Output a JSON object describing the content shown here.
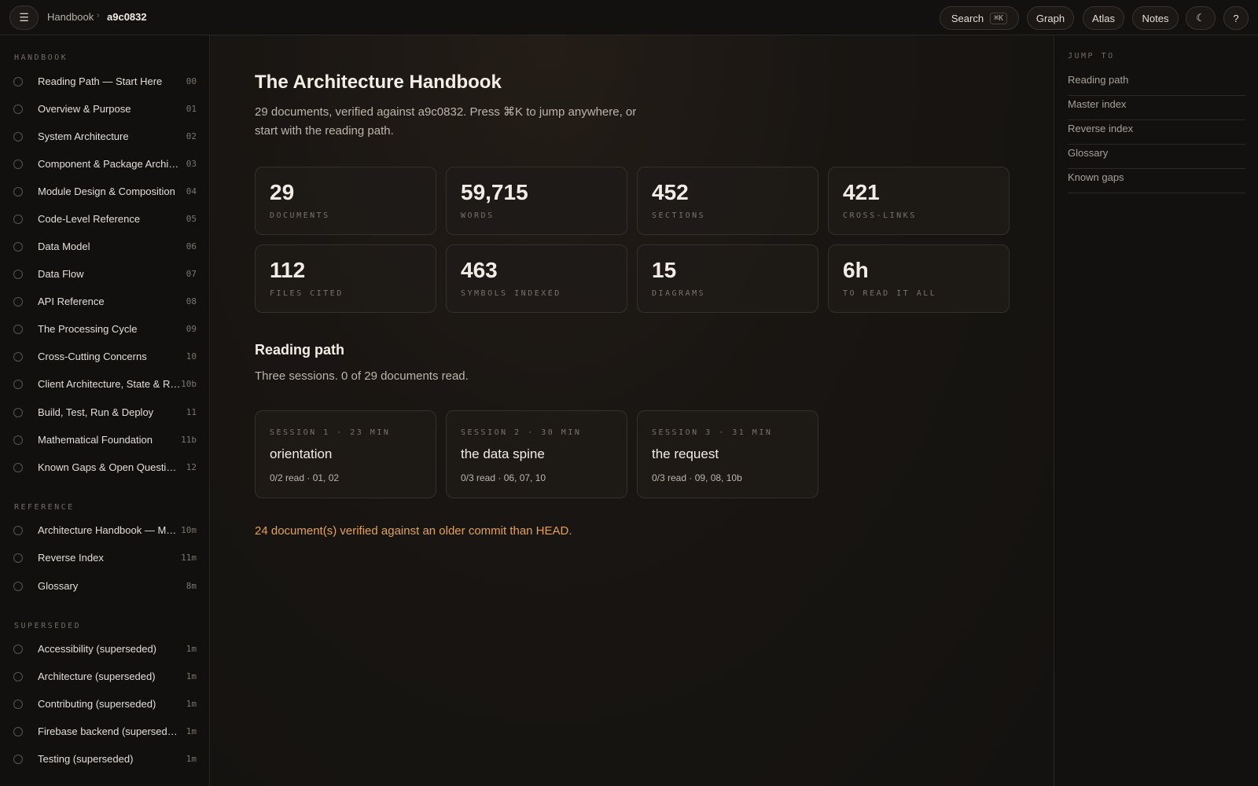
{
  "topbar": {
    "menu_icon": "☰",
    "breadcrumb_root": "Handbook",
    "breadcrumb_sep": "›",
    "breadcrumb_current": "a9c0832",
    "search_label": "Search",
    "search_shortcut": "⌘K",
    "graph_label": "Graph",
    "atlas_label": "Atlas",
    "notes_label": "Notes",
    "theme_icon": "☾",
    "help_label": "?"
  },
  "sidebar": {
    "sections": [
      {
        "label": "HANDBOOK",
        "items": [
          {
            "label": "Reading Path — Start Here",
            "num": "00"
          },
          {
            "label": "Overview & Purpose",
            "num": "01"
          },
          {
            "label": "System Architecture",
            "num": "02"
          },
          {
            "label": "Component & Package Architecture",
            "num": "03"
          },
          {
            "label": "Module Design & Composition",
            "num": "04"
          },
          {
            "label": "Code-Level Reference",
            "num": "05"
          },
          {
            "label": "Data Model",
            "num": "06"
          },
          {
            "label": "Data Flow",
            "num": "07"
          },
          {
            "label": "API Reference",
            "num": "08"
          },
          {
            "label": "The Processing Cycle",
            "num": "09"
          },
          {
            "label": "Cross-Cutting Concerns",
            "num": "10"
          },
          {
            "label": "Client Architecture, State & Rendering",
            "num": "10b"
          },
          {
            "label": "Build, Test, Run & Deploy",
            "num": "11"
          },
          {
            "label": "Mathematical Foundation",
            "num": "11b"
          },
          {
            "label": "Known Gaps & Open Questions",
            "num": "12"
          }
        ]
      },
      {
        "label": "REFERENCE",
        "items": [
          {
            "label": "Architecture Handbook — Master Index",
            "num": "10m"
          },
          {
            "label": "Reverse Index",
            "num": "11m"
          },
          {
            "label": "Glossary",
            "num": "8m"
          }
        ]
      },
      {
        "label": "SUPERSEDED",
        "items": [
          {
            "label": "Accessibility (superseded)",
            "num": "1m"
          },
          {
            "label": "Architecture (superseded)",
            "num": "1m"
          },
          {
            "label": "Contributing (superseded)",
            "num": "1m"
          },
          {
            "label": "Firebase backend (superseded)",
            "num": "1m"
          },
          {
            "label": "Testing (superseded)",
            "num": "1m"
          }
        ]
      }
    ]
  },
  "main": {
    "title": "The Architecture Handbook",
    "subtitle": "29 documents, verified against a9c0832. Press ⌘K to jump anywhere, or start with the reading path.",
    "stats": [
      {
        "value": "29",
        "label": "DOCUMENTS"
      },
      {
        "value": "59,715",
        "label": "WORDS"
      },
      {
        "value": "452",
        "label": "SECTIONS"
      },
      {
        "value": "421",
        "label": "CROSS-LINKS"
      },
      {
        "value": "112",
        "label": "FILES CITED"
      },
      {
        "value": "463",
        "label": "SYMBOLS INDEXED"
      },
      {
        "value": "15",
        "label": "DIAGRAMS"
      },
      {
        "value": "6h",
        "label": "TO READ IT ALL"
      }
    ],
    "reading_path": {
      "title": "Reading path",
      "subtitle": "Three sessions. 0 of 29 documents read.",
      "sessions": [
        {
          "meta": "SESSION 1 · 23 MIN",
          "title": "orientation",
          "progress": "0/2 read · 01, 02"
        },
        {
          "meta": "SESSION 2 · 30 MIN",
          "title": "the data spine",
          "progress": "0/3 read · 06, 07, 10"
        },
        {
          "meta": "SESSION 3 · 31 MIN",
          "title": "the request",
          "progress": "0/3 read · 09, 08, 10b"
        }
      ]
    },
    "warning": "24 document(s) verified against an older commit than HEAD."
  },
  "rail": {
    "label": "JUMP TO",
    "links": [
      "Reading path",
      "Master index",
      "Reverse index",
      "Glossary",
      "Known gaps"
    ]
  },
  "colors": {
    "background": "#141210",
    "accent_warning": "#e0a25a",
    "card_border": "#35302a"
  }
}
